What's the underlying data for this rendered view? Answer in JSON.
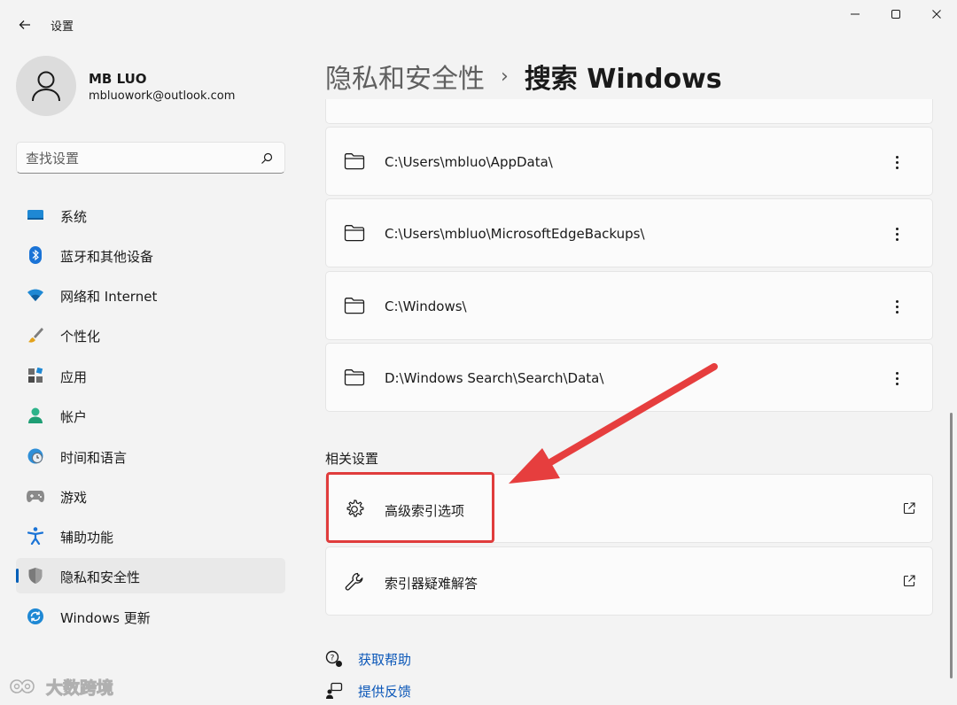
{
  "window": {
    "title": "设置",
    "minimize": "minimize",
    "maximize": "maximize",
    "close": "close"
  },
  "profile": {
    "name": "MB LUO",
    "email": "mbluowork@outlook.com"
  },
  "search": {
    "placeholder": "查找设置"
  },
  "sidebar": {
    "items": [
      {
        "label": "系统",
        "icon": "monitor-icon",
        "active": false
      },
      {
        "label": "蓝牙和其他设备",
        "icon": "bluetooth-icon",
        "active": false
      },
      {
        "label": "网络和 Internet",
        "icon": "wifi-icon",
        "active": false
      },
      {
        "label": "个性化",
        "icon": "brush-icon",
        "active": false
      },
      {
        "label": "应用",
        "icon": "apps-icon",
        "active": false
      },
      {
        "label": "帐户",
        "icon": "person-icon",
        "active": false
      },
      {
        "label": "时间和语言",
        "icon": "clock-globe-icon",
        "active": false
      },
      {
        "label": "游戏",
        "icon": "gamepad-icon",
        "active": false
      },
      {
        "label": "辅助功能",
        "icon": "accessibility-icon",
        "active": false
      },
      {
        "label": "隐私和安全性",
        "icon": "shield-icon",
        "active": true
      },
      {
        "label": "Windows 更新",
        "icon": "update-icon",
        "active": false
      }
    ]
  },
  "header": {
    "parent": "隐私和安全性",
    "separator": "›",
    "current": "搜索 Windows"
  },
  "folders": [
    {
      "path": "C:\\Users\\mbluo\\AppData\\"
    },
    {
      "path": "C:\\Users\\mbluo\\MicrosoftEdgeBackups\\"
    },
    {
      "path": "C:\\Windows\\"
    },
    {
      "path": "D:\\Windows Search\\Search\\Data\\"
    }
  ],
  "related": {
    "title": "相关设置",
    "items": [
      {
        "label": "高级索引选项",
        "icon": "gear-icon"
      },
      {
        "label": "索引器疑难解答",
        "icon": "wrench-icon"
      }
    ]
  },
  "help": {
    "get_help": "获取帮助",
    "feedback": "提供反馈"
  },
  "watermark": {
    "text": "大数跨境"
  },
  "colors": {
    "accent": "#005fb8",
    "link": "#0b57b8",
    "annotation": "#e03c3c",
    "background": "#f3f3f3",
    "card": "#fbfbfb"
  }
}
